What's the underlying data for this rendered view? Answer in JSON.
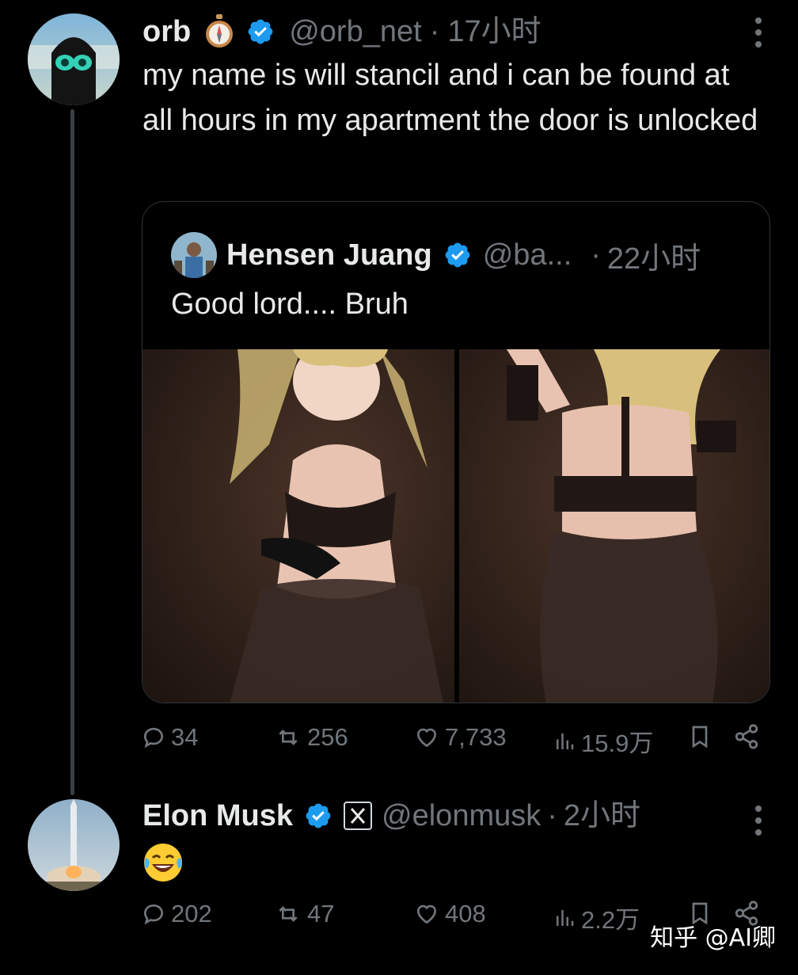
{
  "tweet1": {
    "name": "orb",
    "handle": "@orb_net",
    "dot": "·",
    "time": "17小时",
    "text": "my name is will stancil and i can be found at all hours in my apartment the door is unlocked",
    "badge_color": "#1d9bf0",
    "quote": {
      "name": "Hensen Juang",
      "handle": "@ba...",
      "dot": "·",
      "time": "22小时",
      "text": "Good lord.... Bruh",
      "media_count": 2
    },
    "actions": {
      "replies": "34",
      "reposts": "256",
      "likes": "7,733",
      "views": "15.9万"
    }
  },
  "tweet2": {
    "name": "Elon Musk",
    "handle": "@elonmusk",
    "dot": "·",
    "time": "2小时",
    "text_emoji": "face-with-tears-of-joy",
    "actions": {
      "replies": "202",
      "reposts": "47",
      "likes": "408",
      "views": "2.2万"
    }
  },
  "watermark": "知乎 @AI卿",
  "colors": {
    "background": "#000000",
    "muted": "#71767b",
    "verified": "#1d9bf0"
  }
}
